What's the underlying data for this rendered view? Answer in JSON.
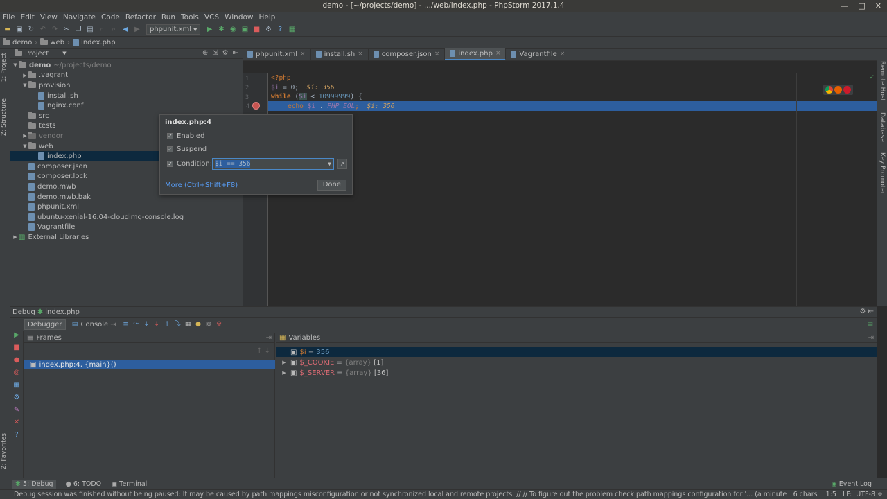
{
  "window": {
    "title": "demo - [~/projects/demo] - .../web/index.php - PhpStorm 2017.1.4"
  },
  "menu": [
    "File",
    "Edit",
    "View",
    "Navigate",
    "Code",
    "Refactor",
    "Run",
    "Tools",
    "VCS",
    "Window",
    "Help"
  ],
  "toolbar": {
    "run_config": "phpunit.xml"
  },
  "breadcrumbs": [
    "demo",
    "web",
    "index.php"
  ],
  "left_strip": {
    "project_tab": "1: Project",
    "structure_tab": "Z: Structure",
    "favorites_tab": "2: Favorites"
  },
  "right_strip": {
    "remote_host": "Remote Host",
    "database": "Database",
    "key_promoter": "Key Promoter"
  },
  "project_panel": {
    "header": "Project",
    "tree": [
      {
        "label": "demo",
        "suffix": "~/projects/demo",
        "level": 0,
        "type": "folder",
        "expanded": true
      },
      {
        "label": ".vagrant",
        "level": 1,
        "type": "folder",
        "expanded": false
      },
      {
        "label": "provision",
        "level": 1,
        "type": "folder",
        "expanded": true
      },
      {
        "label": "install.sh",
        "level": 2,
        "type": "file"
      },
      {
        "label": "nginx.conf",
        "level": 2,
        "type": "file"
      },
      {
        "label": "src",
        "level": 1,
        "type": "folder"
      },
      {
        "label": "tests",
        "level": 1,
        "type": "folder"
      },
      {
        "label": "vendor",
        "level": 1,
        "type": "folder",
        "expanded": false,
        "dim": true
      },
      {
        "label": "web",
        "level": 1,
        "type": "folder",
        "expanded": true
      },
      {
        "label": "index.php",
        "level": 2,
        "type": "file",
        "selected": true
      },
      {
        "label": "composer.json",
        "level": 1,
        "type": "file"
      },
      {
        "label": "composer.lock",
        "level": 1,
        "type": "file"
      },
      {
        "label": "demo.mwb",
        "level": 1,
        "type": "file"
      },
      {
        "label": "demo.mwb.bak",
        "level": 1,
        "type": "file"
      },
      {
        "label": "phpunit.xml",
        "level": 1,
        "type": "file"
      },
      {
        "label": "ubuntu-xenial-16.04-cloudimg-console.log",
        "level": 1,
        "type": "file"
      },
      {
        "label": "Vagrantfile",
        "level": 1,
        "type": "file"
      },
      {
        "label": "External Libraries",
        "level": 0,
        "type": "lib",
        "expanded": false
      }
    ]
  },
  "editor": {
    "tabs": [
      {
        "label": "phpunit.xml",
        "active": false
      },
      {
        "label": "install.sh",
        "active": false
      },
      {
        "label": "composer.json",
        "active": false
      },
      {
        "label": "index.php",
        "active": true
      },
      {
        "label": "Vagrantfile",
        "active": false
      }
    ],
    "line_numbers": [
      "1",
      "2",
      "3",
      "4"
    ],
    "code": {
      "l1": "<?php",
      "l2_var": "$i",
      "l2_rest": " = 0;",
      "l2_inline": "  $i: 356",
      "l3_kw": "while",
      "l3_a": " (",
      "l3_var": "$i",
      "l3_b": " < ",
      "l3_num": "10999999",
      "l3_c": ") {",
      "l4_kw": "echo",
      "l4_var": " $i",
      "l4_b": " . ",
      "l4_const": "PHP_EOL",
      "l4_c": ";",
      "l4_inline": "  $i: 356"
    }
  },
  "breakpoint_popup": {
    "title": "index.php:4",
    "enabled_label": "Enabled",
    "suspend_label": "Suspend",
    "condition_label": "Condition:",
    "condition_value": "$i == 356",
    "more_link": "More (Ctrl+Shift+F8)",
    "done_button": "Done"
  },
  "debug": {
    "title": "Debug",
    "config": "index.php",
    "tabs": {
      "debugger": "Debugger",
      "console": "Console"
    },
    "frames_header": "Frames",
    "frame": "index.php:4, {main}()",
    "variables_header": "Variables",
    "variables": [
      {
        "name": "$i",
        "eq": " = ",
        "value": "356"
      },
      {
        "name": "$_COOKIE",
        "eq": " = ",
        "type": "{array}",
        "value": "[1]"
      },
      {
        "name": "$_SERVER",
        "eq": " = ",
        "type": "{array}",
        "value": "[36]"
      }
    ]
  },
  "bottom_tabs": {
    "debug": "5: Debug",
    "todo": "6: TODO",
    "terminal": "Terminal",
    "event_log": "Event Log"
  },
  "status": {
    "message": "Debug session was finished without being paused: It may be caused by path mappings misconfiguration or not synchronized local and remote projects. // // To figure out the problem check path mappings configuration for '... (a minute ago)",
    "chars": "6 chars",
    "position": "1:5",
    "line_sep": "LF:",
    "encoding": "UTF-8"
  }
}
